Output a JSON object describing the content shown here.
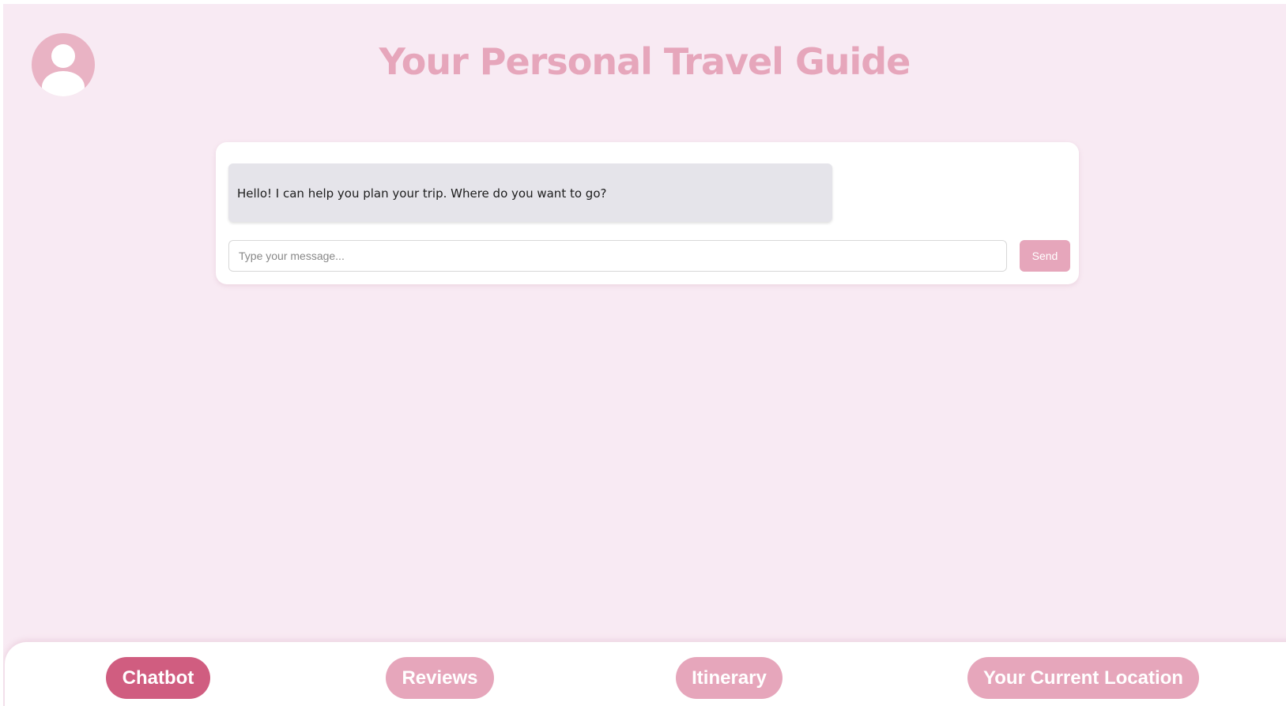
{
  "header": {
    "title": "Your Personal Travel Guide",
    "avatar_icon": "user-avatar-icon"
  },
  "chat": {
    "messages": [
      {
        "sender": "bot",
        "text": "Hello! I can help you plan your trip. Where do you want to go?"
      }
    ],
    "input": {
      "value": "",
      "placeholder": "Type your message..."
    },
    "send_label": "Send"
  },
  "nav": {
    "items": [
      {
        "label": "Chatbot",
        "active": true
      },
      {
        "label": "Reviews",
        "active": false
      },
      {
        "label": "Itinerary",
        "active": false
      },
      {
        "label": "Your Current Location",
        "active": false
      }
    ]
  },
  "colors": {
    "page_background": "#f8eaf3",
    "accent": "#e6a6bb",
    "active_accent": "#d05d80",
    "bot_bubble": "#e5e4ea"
  }
}
